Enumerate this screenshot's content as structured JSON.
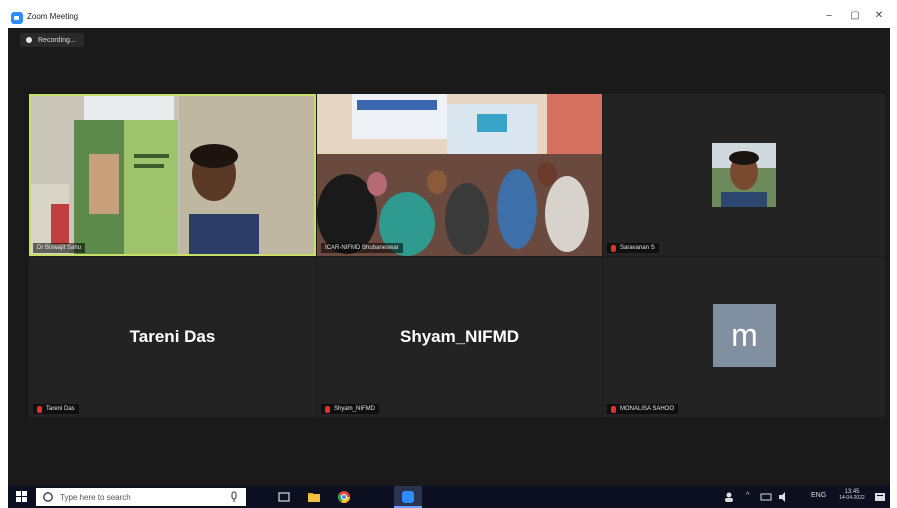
{
  "window": {
    "title": "Zoom Meeting",
    "minimize": "–",
    "maximize": "▢",
    "close": "✕"
  },
  "recording": {
    "label": "Recording..."
  },
  "participants": [
    {
      "name": "Dr Biswajit Sahu"
    },
    {
      "name": "ICAR-NIFMD Bhubaneswar"
    },
    {
      "name": "Saravanan S"
    },
    {
      "name": "Tareni Das",
      "display": "Tareni Das"
    },
    {
      "name": "Shyam_NIFMD",
      "display": "Shyam_NIFMD"
    },
    {
      "name": "MONALISA SAHOO",
      "avatar_letter": "m"
    }
  ],
  "taskbar": {
    "search_placeholder": "Type here to search",
    "lang": "ENG",
    "time": "13:45",
    "date": "14-04-2022"
  },
  "colors": {
    "active_border": "#c8e06a",
    "avatar_bg": "#8190a0",
    "mic_off": "#e0302b"
  }
}
